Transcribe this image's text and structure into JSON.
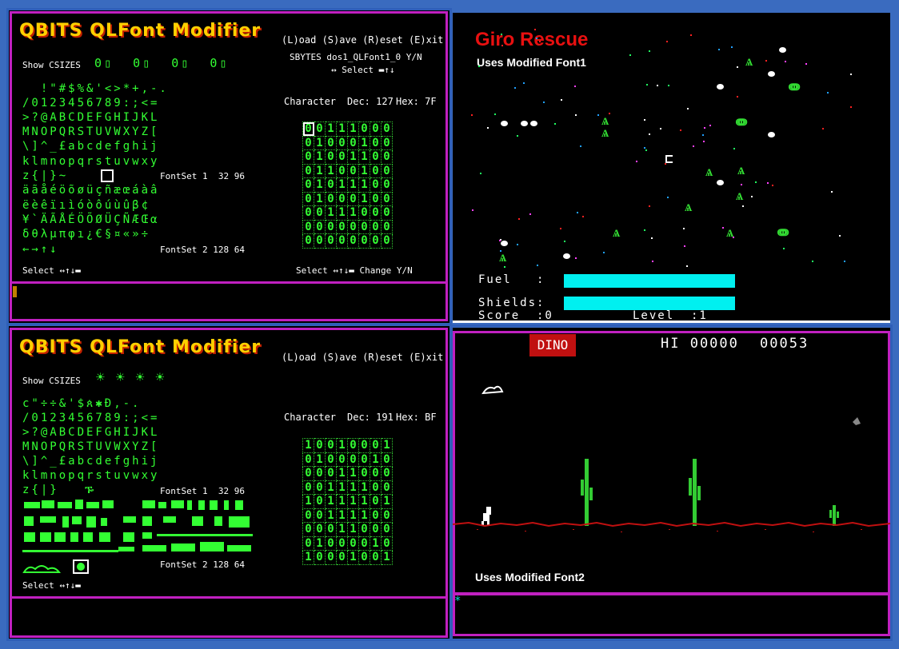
{
  "editor1": {
    "title": "QBITS QLFont Modifier",
    "menu": "(L)oad (S)ave (R)eset (E)xit",
    "sbytes": "SBYTES dos1_QLFont1_0 Y/N",
    "nav": "↔ Select ▬↑↓",
    "show_csizes": "Show CSIZES",
    "csizes": "0▯  0▯  0▯  0▯",
    "character_label": "Character",
    "dec": "Dec: 127",
    "hex": "Hex: 7F",
    "charset_rows": [
      "  !\"#$%&'<>*+,-.",
      "/0123456789:;<=",
      ">?@ABCDEFGHIJKL",
      "MNOPQRSTUVWXYZ[",
      "\\]^_£abcdefghij",
      "klmnopqrstuvwxy",
      "z{|}~",
      "äãåéöõøüçñæœáàâ",
      "ëèêïıìóòôúùûβ¢",
      "¥`ÄÃÅÉÖÕØÜÇÑÆŒα",
      "δθλμπφı¿€§¤«»÷",
      "←→↑↓"
    ],
    "fontset1": "FontSet 1  32 96",
    "fontset2": "FontSet 2 128 64",
    "select_left": "Select ↔↑↓▬",
    "select_right": "Select ↔↑↓▬ Change Y/N",
    "bits": [
      "00111000",
      "01000100",
      "01001100",
      "01100100",
      "01011100",
      "01000100",
      "00111000",
      "00000000",
      "00000000"
    ]
  },
  "editor2": {
    "title": "QBITS QLFont Modifier",
    "menu": "(L)oad (S)ave (R)eset (E)xit",
    "show_csizes": "Show CSIZES",
    "character_label": "Character",
    "dec": "Dec: 191",
    "hex": "Hex: BF",
    "charset_rows": [
      "",
      "/0123456789:;<=",
      ">?@ABCDEFGHIJKL",
      "MNOPQRSTUVWXYZ[",
      "\\]^_£abcdefghij",
      "klmnopqrstuvwxy",
      "z{|}"
    ],
    "fontset1": "FontSet 1  32 96",
    "fontset2": "FontSet 2 128 64",
    "select_left": "Select ↔↑↓▬",
    "bits": [
      "10010001",
      "01000010",
      "00011000",
      "00111100",
      "10111101",
      "00111100",
      "00011000",
      "01000010",
      "10001001"
    ]
  },
  "giro": {
    "title": "Giro Rescue",
    "subtitle": "Uses Modified Font1",
    "fuel_label": "Fuel   :",
    "shields_label": "Shields:",
    "score_label": "Score  :0",
    "level_label": "Level  :1",
    "fuel_level": 1.0,
    "shields_level": 1.0
  },
  "dino": {
    "badge": "DINO",
    "hi": "HI 00000",
    "score": "00053",
    "caption": "Uses Modified Font2",
    "prompt": "*"
  },
  "colors": {
    "background": "#3a6bbf",
    "frame": "#c020c0",
    "green": "#33ff33",
    "title_yellow": "#ffd000",
    "giro_red": "#e81010",
    "cyan": "#00f0f0",
    "ground_red": "#c01010"
  }
}
